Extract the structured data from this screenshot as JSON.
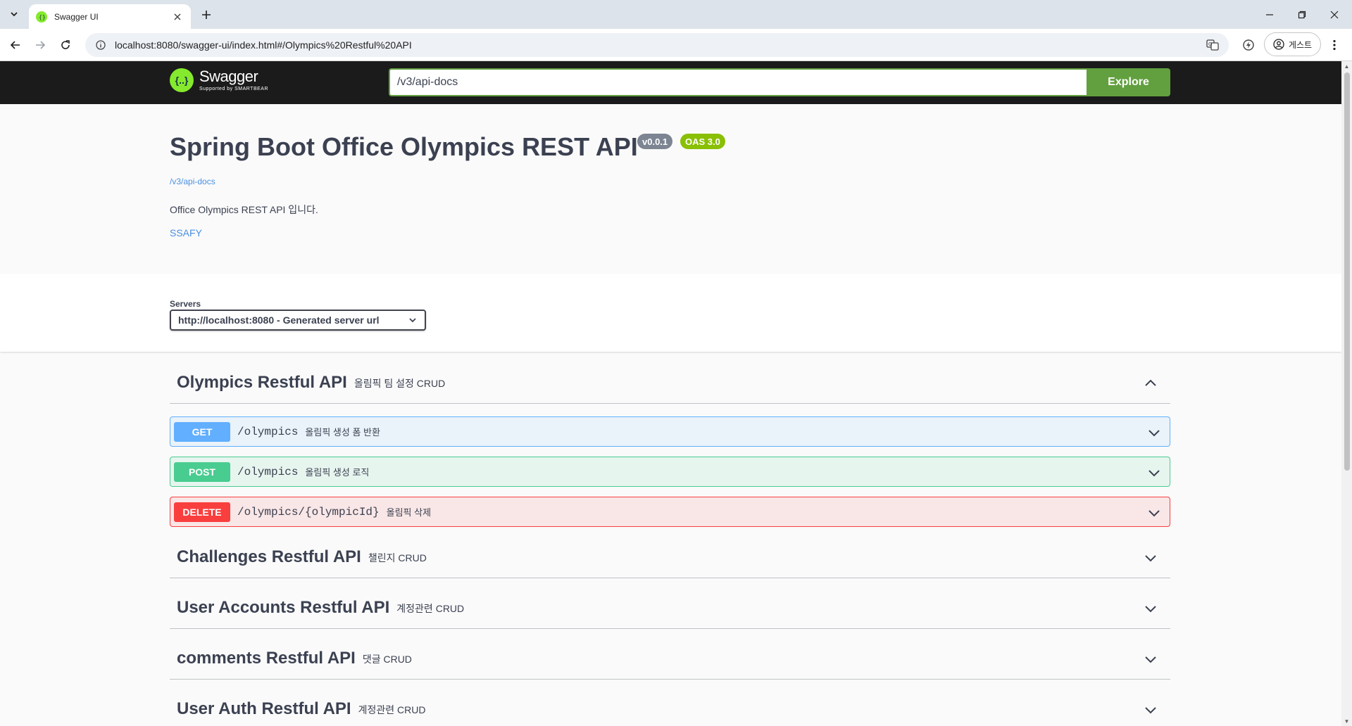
{
  "browser": {
    "tab_title": "Swagger UI",
    "url": "localhost:8080/swagger-ui/index.html#/Olympics%20Restful%20API",
    "profile_label": "게스트"
  },
  "topbar": {
    "logo_text": "Swagger",
    "logo_sub": "Supported by SMARTBEAR",
    "spec_url": "/v3/api-docs",
    "explore_label": "Explore"
  },
  "info": {
    "title": "Spring Boot Office Olympics REST API",
    "version": "v0.0.1",
    "oas": "OAS 3.0",
    "api_link": "/v3/api-docs",
    "description": "Office Olympics REST API 입니다.",
    "contact": "SSAFY"
  },
  "servers": {
    "label": "Servers",
    "selected": "http://localhost:8080 - Generated server url"
  },
  "tags": [
    {
      "name": "Olympics Restful API",
      "description": "올림픽 팀 설정 CRUD",
      "expanded": true,
      "operations": [
        {
          "method": "GET",
          "path": "/olympics",
          "summary": "올림픽 생성 폼 반환"
        },
        {
          "method": "POST",
          "path": "/olympics",
          "summary": "올림픽 생성 로직"
        },
        {
          "method": "DELETE",
          "path": "/olympics/{olympicId}",
          "summary": "올림픽 삭제"
        }
      ]
    },
    {
      "name": "Challenges Restful API",
      "description": "챌린지 CRUD",
      "expanded": false
    },
    {
      "name": "User Accounts Restful API",
      "description": "계정관련 CRUD",
      "expanded": false
    },
    {
      "name": "comments Restful API",
      "description": "댓글 CRUD",
      "expanded": false
    },
    {
      "name": "User Auth Restful API",
      "description": "계정관련 CRUD",
      "expanded": false
    }
  ],
  "colors": {
    "get": "#61affe",
    "post": "#49cc90",
    "delete": "#f93e3e",
    "explore": "#62a03f",
    "topbar": "#1b1b1b"
  }
}
